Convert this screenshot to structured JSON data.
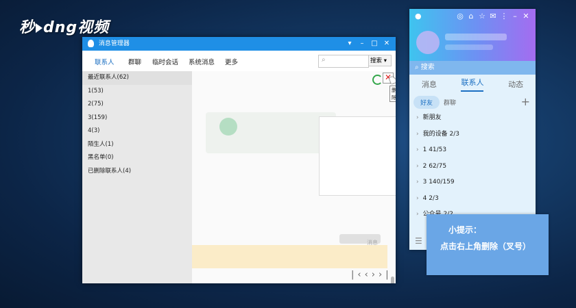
{
  "watermark": {
    "pre": "秒",
    "mid": "d",
    "post": "ng视频"
  },
  "qq_panel": {
    "search_placeholder": "搜索",
    "tabs": [
      "消息",
      "联系人",
      "动态"
    ],
    "subtabs": [
      "好友",
      "群聊"
    ],
    "groups": [
      "新朋友",
      "我的设备 2/3",
      "1 41/53",
      "2 62/75",
      "3 140/159",
      "4 2/3",
      "公众号 2/2"
    ]
  },
  "manager": {
    "title": "消息管理器",
    "nav": [
      "联系人",
      "群聊",
      "临时会话",
      "系统消息",
      "更多"
    ],
    "search_button": "搜索",
    "sidebar": [
      "最近联系人(62)",
      "1(53)",
      "2(75)",
      "3(159)",
      "4(3)",
      "陌生人(1)",
      "黑名单(0)",
      "已删除联系人(4)"
    ],
    "delete_tooltip": "删除",
    "blur_snippet": "消息"
  },
  "tip": {
    "line1": "小提示：",
    "line2": "点击右上角删除（叉号）"
  },
  "colors": {
    "accent": "#1f8fe6",
    "tip_bg": "#6aa6e6",
    "delete": "#e02020"
  }
}
